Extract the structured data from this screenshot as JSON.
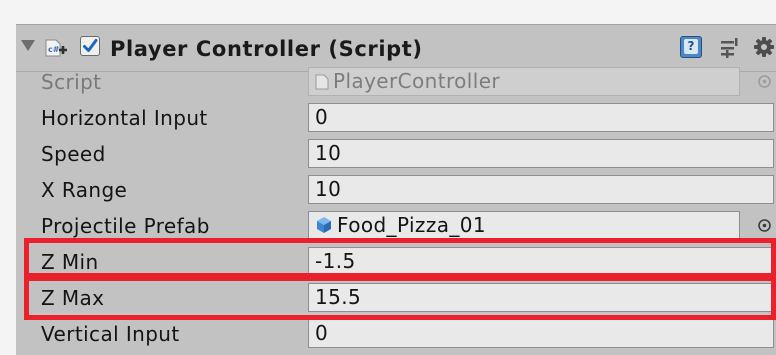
{
  "component": {
    "title": "Player Controller (Script)",
    "enabled": true
  },
  "fields": {
    "script": {
      "label": "Script",
      "value": "PlayerController"
    },
    "horizontal_input": {
      "label": "Horizontal Input",
      "value": "0"
    },
    "speed": {
      "label": "Speed",
      "value": "10"
    },
    "x_range": {
      "label": "X Range",
      "value": "10"
    },
    "projectile_prefab": {
      "label": "Projectile Prefab",
      "value": "Food_Pizza_01"
    },
    "z_min": {
      "label": "Z Min",
      "value": "-1.5"
    },
    "z_max": {
      "label": "Z Max",
      "value": "15.5"
    },
    "vertical_input": {
      "label": "Vertical Input",
      "value": "0"
    }
  },
  "icons": {
    "foldout": "foldout-arrow-icon",
    "script": "csharp-script-icon",
    "help": "help-book-icon",
    "presets": "presets-sliders-icon",
    "settings": "gear-icon",
    "prefab": "prefab-cube-icon",
    "object_picker": "object-picker-icon"
  },
  "colors": {
    "highlight": "#e8212b",
    "panel": "#c2c2c2",
    "field": "#e9e9e9",
    "prefab_icon": "#4a90d9"
  }
}
